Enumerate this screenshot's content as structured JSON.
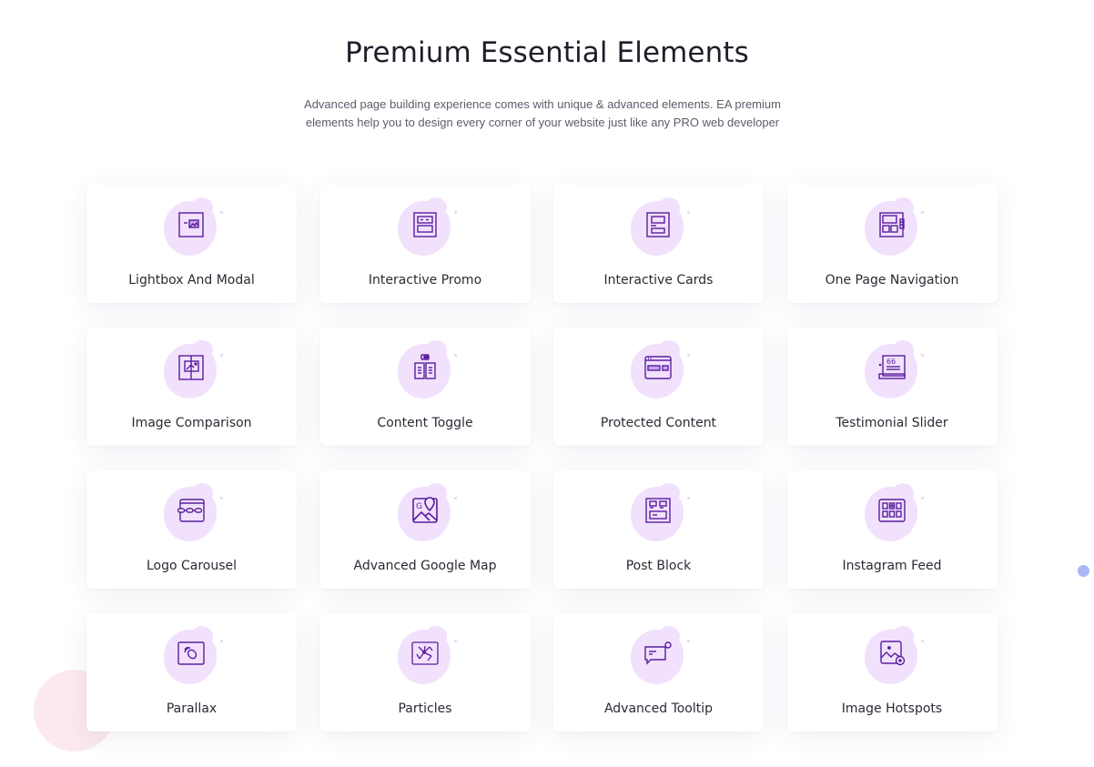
{
  "header": {
    "title": "Premium Essential Elements",
    "subtitle_line1": "Advanced page building experience comes with unique & advanced elements. EA premium",
    "subtitle_line2": "elements help you to design every corner of your website just like any PRO web developer"
  },
  "colors": {
    "icon_stroke": "#5a1d9e",
    "blob": "#f1e1fc",
    "deco_circle": "#fbe9ef",
    "deco_dot": "#a9b7f5"
  },
  "elements": [
    {
      "label": "Lightbox And Modal",
      "icon": "lightbox-icon"
    },
    {
      "label": "Interactive Promo",
      "icon": "interactive-promo-icon"
    },
    {
      "label": "Interactive Cards",
      "icon": "interactive-cards-icon"
    },
    {
      "label": "One Page Navigation",
      "icon": "one-page-navigation-icon"
    },
    {
      "label": "Image Comparison",
      "icon": "image-comparison-icon"
    },
    {
      "label": "Content Toggle",
      "icon": "content-toggle-icon"
    },
    {
      "label": "Protected Content",
      "icon": "protected-content-icon"
    },
    {
      "label": "Testimonial Slider",
      "icon": "testimonial-slider-icon"
    },
    {
      "label": "Logo Carousel",
      "icon": "logo-carousel-icon"
    },
    {
      "label": "Advanced Google Map",
      "icon": "google-map-icon"
    },
    {
      "label": "Post Block",
      "icon": "post-block-icon"
    },
    {
      "label": "Instagram Feed",
      "icon": "instagram-feed-icon"
    },
    {
      "label": "Parallax",
      "icon": "parallax-icon"
    },
    {
      "label": "Particles",
      "icon": "particles-icon"
    },
    {
      "label": "Advanced Tooltip",
      "icon": "tooltip-icon"
    },
    {
      "label": "Image Hotspots",
      "icon": "image-hotspots-icon"
    }
  ]
}
